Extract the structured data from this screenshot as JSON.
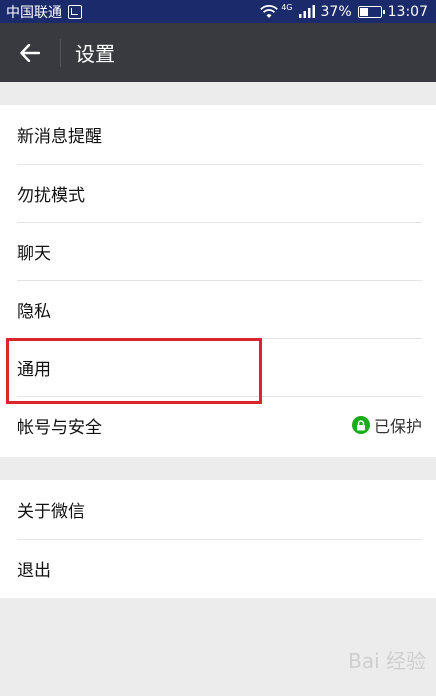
{
  "status_bar": {
    "carrier": "中国联通",
    "battery": "37%",
    "time": "13:07",
    "network": "4G"
  },
  "header": {
    "title": "设置"
  },
  "settings_group_1": [
    {
      "label": "新消息提醒"
    },
    {
      "label": "勿扰模式"
    },
    {
      "label": "聊天"
    },
    {
      "label": "隐私"
    },
    {
      "label": "通用"
    },
    {
      "label": "帐号与安全",
      "status": "已保护"
    }
  ],
  "settings_group_2": [
    {
      "label": "关于微信"
    },
    {
      "label": "退出"
    }
  ],
  "watermark": "Bai 经验",
  "colors": {
    "status_bar": "#1b2a6b",
    "title_bar": "#393a3f",
    "highlight": "#d9252b",
    "protected_badge": "#1aad19"
  }
}
